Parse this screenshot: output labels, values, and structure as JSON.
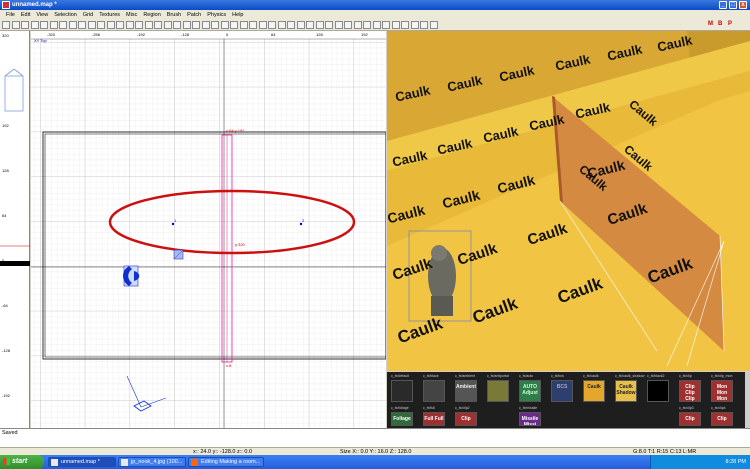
{
  "window": {
    "title": "unnamed.map *",
    "min": "_",
    "max": "□",
    "close": "x"
  },
  "menu": [
    "File",
    "Edit",
    "View",
    "Selection",
    "Grid",
    "Textures",
    "Misc",
    "Region",
    "Brush",
    "Patch",
    "Physics",
    "Help"
  ],
  "toolbar": {
    "right_letters": [
      "M",
      "B",
      "P"
    ]
  },
  "view2d": {
    "label": "XY Top",
    "hruler": [
      "-320",
      "-256",
      "-192",
      "-128",
      "-64",
      "0",
      "64",
      "128",
      "192",
      "256"
    ],
    "vruler": [
      "320",
      "256",
      "192",
      "128",
      "64",
      "0",
      "-64",
      "-128",
      "-192"
    ],
    "brush_label": "x:64 y:192",
    "brush_side_label": "y:320",
    "brush_bottom_label": "x:8",
    "point1": "1",
    "point2": "2"
  },
  "camera": {
    "texture_word": "Caulk"
  },
  "textures": [
    {
      "name": "c_fx/default",
      "label": "",
      "bg": "#2a2a2a",
      "fg": "#ddd"
    },
    {
      "name": "c_fx/black",
      "label": "",
      "bg": "#444",
      "fg": "#ddd"
    },
    {
      "name": "c_fx/ambient",
      "label": "Ambient",
      "bg": "#555",
      "fg": "#eee"
    },
    {
      "name": "c_fx/antiportal",
      "label": "",
      "bg": "#7a7a38",
      "fg": "#eee"
    },
    {
      "name": "c_fx/auto",
      "label": "AUTO Adjust",
      "bg": "#2f7d4c",
      "fg": "#ccffcc"
    },
    {
      "name": "c_fx/bcs",
      "label": "BCS",
      "bg": "#2d3f6e",
      "fg": "#aab"
    },
    {
      "name": "c_fx/caulk",
      "label": "Caulk",
      "bg": "#e3a82b",
      "fg": "#222"
    },
    {
      "name": "c_fx/caulk_shadow",
      "label": "Caulk Shadow",
      "bg": "#e6c04a",
      "fg": "#222"
    },
    {
      "name": "c_fx/black2",
      "label": "",
      "bg": "#000",
      "fg": "#fff"
    },
    {
      "name": "c_fx/clip",
      "label": "Clip Clip Clip",
      "bg": "#a03030",
      "fg": "#fff"
    },
    {
      "name": "c_fx/clip_mon",
      "label": "Mon Mon Mon",
      "bg": "#a03030",
      "fg": "#fff"
    }
  ],
  "textures_row2": [
    {
      "name": "c_fx/foliage",
      "label": "Foliage",
      "bg": "#2f6a3a",
      "fg": "#fff"
    },
    {
      "name": "c_fx/full",
      "label": "Full Full",
      "bg": "#a03030",
      "fg": "#fff"
    },
    {
      "name": "c_fx/clip2",
      "label": "Clip",
      "bg": "#a03030",
      "fg": "#fff"
    },
    {
      "name": "c_fx/missile",
      "label": "Missile Missi",
      "bg": "#6a2a8a",
      "fg": "#fff"
    },
    {
      "name": "c_fx/clip3",
      "label": "Clip",
      "bg": "#a03030",
      "fg": "#fff"
    },
    {
      "name": "c_fx/clip4",
      "label": "Clip",
      "bg": "#a03030",
      "fg": "#fff"
    }
  ],
  "console": {
    "text": "Saved"
  },
  "status": {
    "coords": "x:: 24.0  y:: -128.0  z:: 0.0",
    "size": "Size X:: 0.0  Y:: 16.0  Z:: 128.0",
    "grid": "G:8.0 T:1 R:15 C:13 L:MR"
  },
  "taskbar": {
    "start": "start",
    "tasks": [
      "unnamed.map *",
      "jp_nook_4.jpg (100...",
      "Editing Making a room..."
    ],
    "time": "8:28 PM"
  },
  "colors": {
    "grid_bg": "#ffffff",
    "brush_magenta": "#e020a0",
    "ellipse_red": "#cc1010",
    "caulk_yellow": "#e9b93a"
  }
}
